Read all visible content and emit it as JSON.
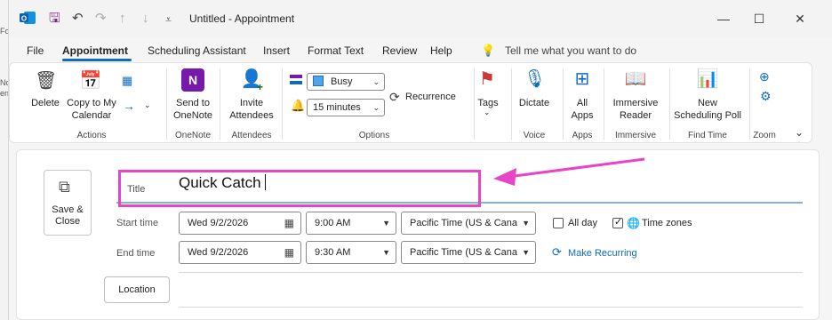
{
  "titlebar": {
    "title": "Untitled  -  Appointment",
    "minimize_glyph": "—",
    "maximize_glyph": "☐",
    "close_glyph": "✕"
  },
  "menu": {
    "tabs": [
      "File",
      "Appointment",
      "Scheduling Assistant",
      "Insert",
      "Format Text",
      "Review",
      "Help"
    ],
    "active_tab": "Appointment",
    "tell_me": "Tell me what you want to do"
  },
  "ribbon": {
    "actions": {
      "delete": "Delete",
      "copy_to_calendar_1": "Copy to My",
      "copy_to_calendar_2": "Calendar",
      "group": "Actions"
    },
    "onenote": {
      "send_1": "Send to",
      "send_2": "OneNote",
      "group": "OneNote"
    },
    "attendees": {
      "invite_1": "Invite",
      "invite_2": "Attendees",
      "group": "Attendees"
    },
    "options": {
      "show_as": "Busy",
      "reminder": "15 minutes",
      "recurrence": "Recurrence",
      "group": "Options"
    },
    "tags": {
      "label": "Tags"
    },
    "voice": {
      "dictate": "Dictate",
      "group": "Voice"
    },
    "apps": {
      "all_1": "All",
      "all_2": "Apps",
      "group": "Apps"
    },
    "immersive": {
      "reader_1": "Immersive",
      "reader_2": "Reader",
      "group": "Immersive"
    },
    "find_time": {
      "poll_1": "New",
      "poll_2": "Scheduling Poll",
      "group": "Find Time"
    },
    "zoom": {
      "group": "Zoom"
    }
  },
  "form": {
    "save_close_1": "Save &",
    "save_close_2": "Close",
    "title_label": "Title",
    "title_value": "Quick Catch",
    "start_label": "Start time",
    "start_date": "Wed 9/2/2026",
    "start_time": "9:00 AM",
    "start_tz": "Pacific Time (US & Cana",
    "end_label": "End time",
    "end_date": "Wed 9/2/2026",
    "end_time": "9:30 AM",
    "end_tz": "Pacific Time (US & Cana",
    "all_day": "All day",
    "all_day_checked": false,
    "time_zones": "Time zones",
    "time_zones_checked": true,
    "make_recurring": "Make Recurring",
    "location_button": "Location"
  },
  "annotation": {
    "highlight_color": "#e844c6"
  },
  "colors": {
    "accent": "#0f6cbd",
    "onenote": "#7719aa",
    "flag": "#d13438"
  }
}
